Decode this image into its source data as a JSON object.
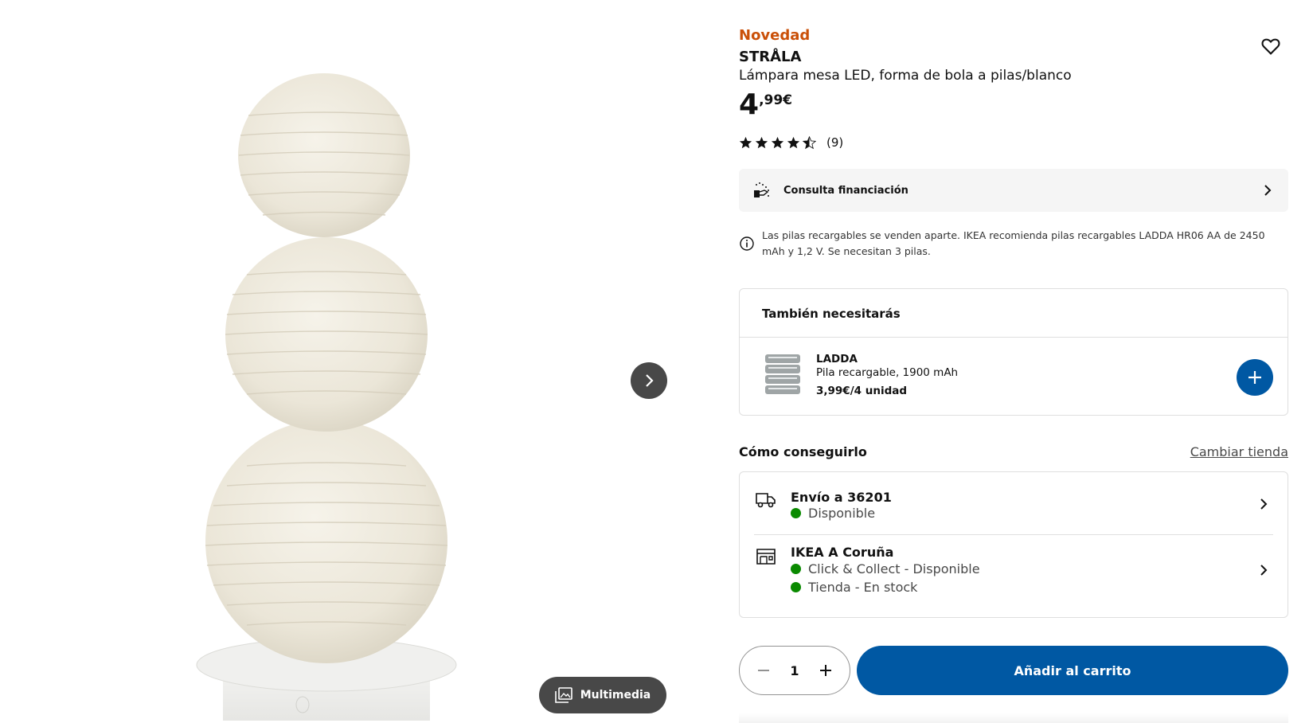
{
  "product": {
    "badge": "Novedad",
    "name": "STRÅLA",
    "description": "Lámpara mesa LED, forma de bola a pilas/blanco",
    "price_integer": "4",
    "price_decimal": ",99€",
    "rating": 4.5,
    "rating_max": 5,
    "review_count": "(9)"
  },
  "gallery": {
    "multimedia_label": "Multimedia"
  },
  "financing": {
    "label": "Consulta financiación"
  },
  "notice": {
    "text": "Las pilas recargables se venden aparte. IKEA recomienda pilas recargables LADDA HR06 AA de 2450 mAh y 1,2 V. Se necesitan 3 pilas."
  },
  "also_need": {
    "title": "También necesitarás",
    "item": {
      "name": "LADDA",
      "description": "Pila recargable, 1900 mAh",
      "price": "3,99€/4 unidad"
    }
  },
  "availability": {
    "title": "Cómo conseguirlo",
    "change_store": "Cambiar tienda",
    "shipping": {
      "title": "Envío a 36201",
      "status": "Disponible"
    },
    "store": {
      "title": "IKEA A Coruña",
      "click_collect": "Click & Collect - Disponible",
      "in_store": "Tienda - En stock"
    }
  },
  "purchase": {
    "quantity": "1",
    "add_to_cart": "Añadir al carrito"
  },
  "colors": {
    "accent": "#0058a3",
    "badge": "#ca5008",
    "available": "#0a8a00"
  }
}
